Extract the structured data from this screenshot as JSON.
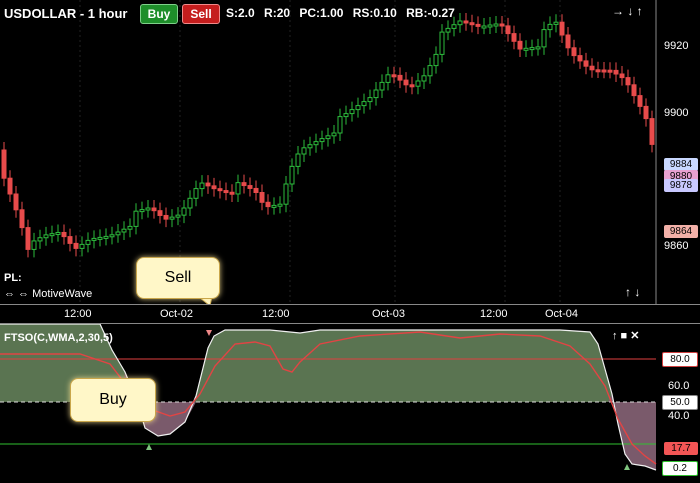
{
  "window": {
    "symbol_title": "USDOLLAR - 1 hour",
    "buy_label": "Buy",
    "sell_label": "Sell",
    "stats": [
      "S:2.0",
      "R:20",
      "PC:1.00",
      "RS:0.10",
      "RB:-0.27"
    ],
    "pl_label": "PL:",
    "logo_text": "MotiveWave",
    "arrows_top_right": "→ ↓ ↑",
    "arrows_bottom_right": "↑ ↓"
  },
  "price_axis": {
    "ticks": [
      "9920",
      "9900",
      "9860"
    ],
    "tags": [
      {
        "label": "9884",
        "color": "#c9d8ff"
      },
      {
        "label": "9880",
        "color": "#e8a0d0"
      },
      {
        "label": "9878",
        "color": "#c8c8ff"
      },
      {
        "label": "9864",
        "color": "#f2b0a8"
      }
    ]
  },
  "time_axis": {
    "labels": [
      "12:00",
      "Oct-02",
      "12:00",
      "Oct-03",
      "12:00",
      "Oct-04"
    ]
  },
  "oscillator": {
    "title": "FTSO(C,WMA,2,30,5)",
    "axis_ticks": [
      "60.0",
      "40.0"
    ],
    "tags": [
      {
        "label": "80.0",
        "color": "#ffffff",
        "border": "#d04040"
      },
      {
        "label": "50.0",
        "color": "#ffffff",
        "border": "#888888"
      },
      {
        "label": "17.7",
        "color": "#f25555",
        "border": "#f25555"
      },
      {
        "label": "0.2",
        "color": "#ffffff",
        "border": "#30c030"
      }
    ],
    "arrows": "↑ ■ ✕"
  },
  "callouts": {
    "sell": "Sell",
    "buy": "Buy"
  },
  "colors": {
    "bull": "#2dbb3d",
    "bear": "#e84b4b",
    "osc_fill_high": "#5f7a55",
    "osc_fill_low": "#7a5a6b"
  }
}
